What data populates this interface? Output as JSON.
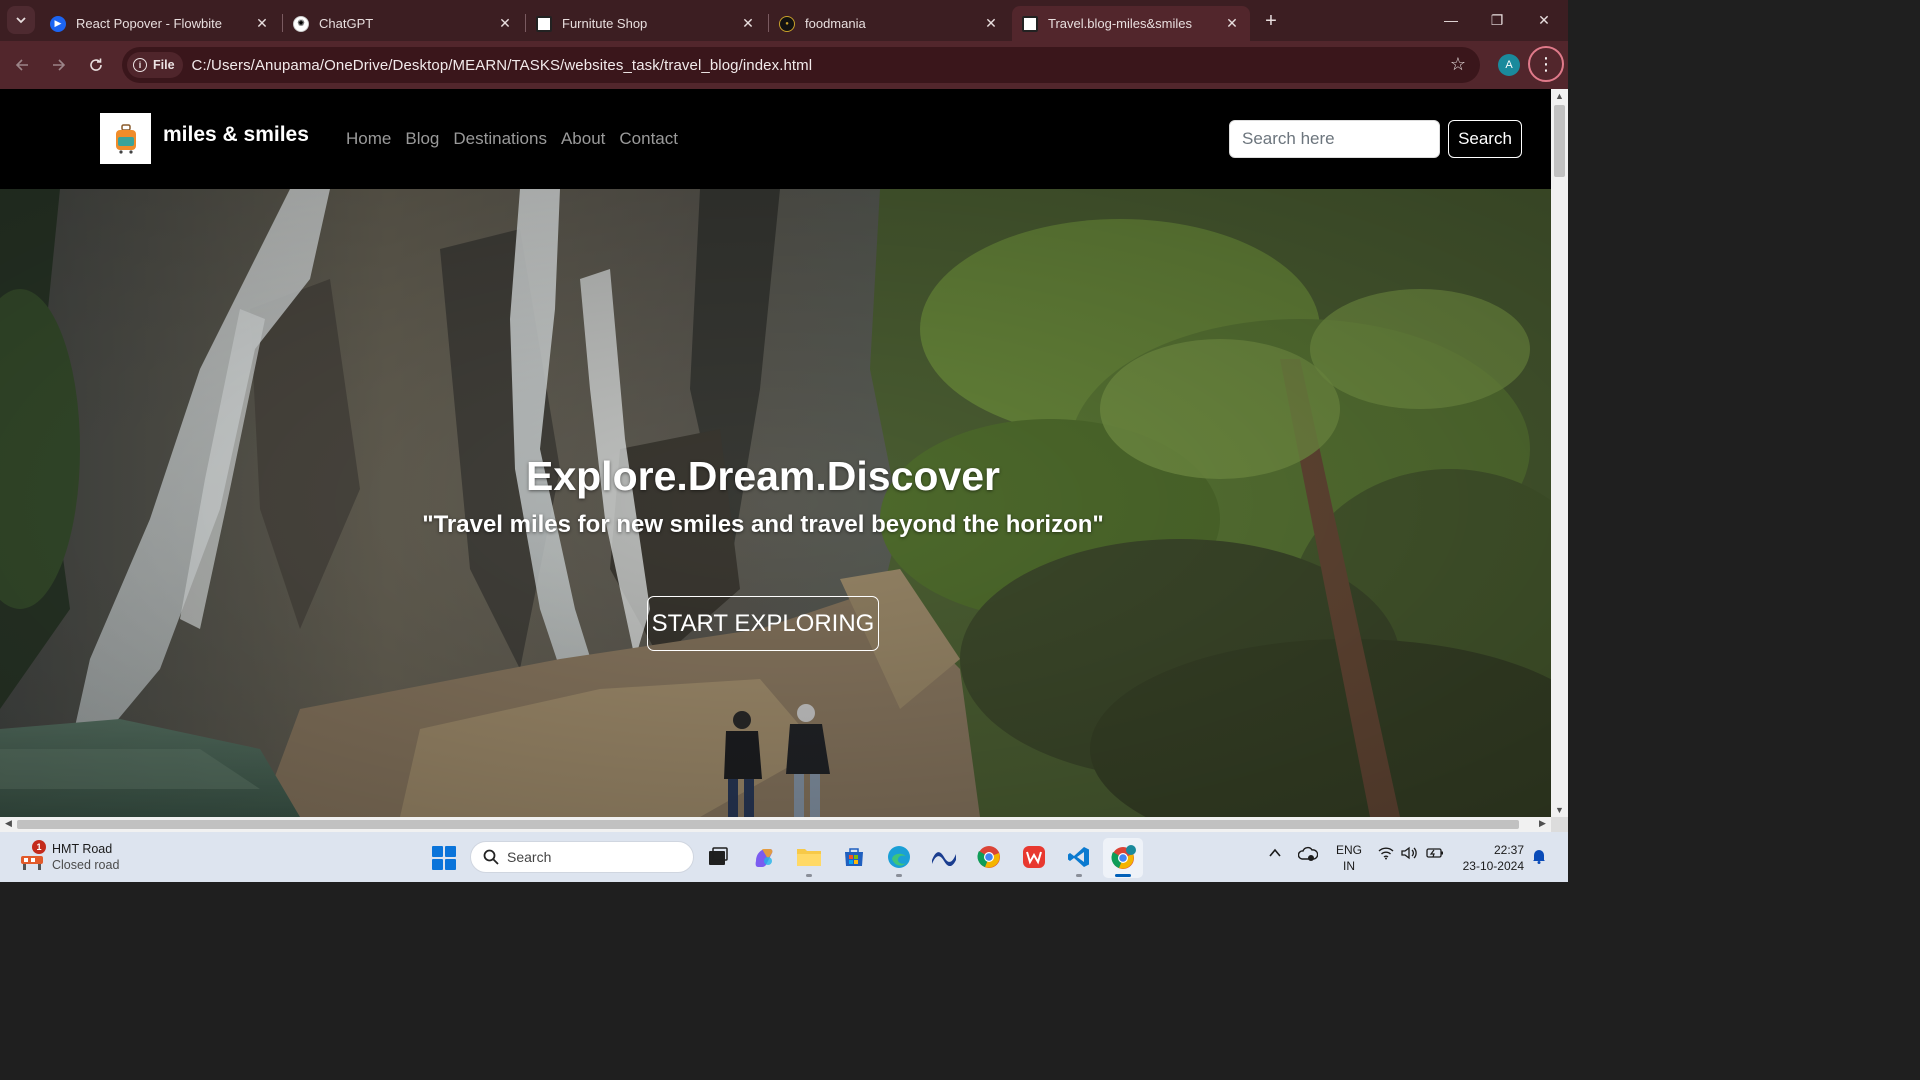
{
  "browser": {
    "tabs": [
      {
        "title": "React Popover - Flowbite",
        "active": false
      },
      {
        "title": "ChatGPT",
        "active": false
      },
      {
        "title": "Furnitute Shop",
        "active": false
      },
      {
        "title": "foodmania",
        "active": false
      },
      {
        "title": "Travel.blog-miles&smiles",
        "active": true
      }
    ],
    "new_tab_label": "+",
    "window_controls": {
      "minimize": "—",
      "restore": "❐",
      "close": "✕"
    },
    "address_bar": {
      "scheme_chip": "File",
      "url": "C:/Users/Anupama/OneDrive/Desktop/MEARN/TASKS/websites_task/travel_blog/index.html"
    },
    "profile_initial": "A",
    "accent_color": "#52262c"
  },
  "site": {
    "brand": "miles & smiles",
    "nav": [
      "Home",
      "Blog",
      "Destinations",
      "About",
      "Contact"
    ],
    "search": {
      "placeholder": "Search here",
      "button": "Search"
    },
    "hero": {
      "title": "Explore.Dream.Discover",
      "subtitle": "\"Travel miles for new smiles and travel beyond the horizon\"",
      "cta": "START EXPLORING"
    }
  },
  "taskbar": {
    "weather": {
      "title": "HMT Road",
      "subtitle": "Closed road",
      "badge": "1"
    },
    "search_label": "Search",
    "apps": [
      "task-view",
      "copilot",
      "file-explorer",
      "microsoft-store",
      "edge",
      "vpn",
      "chrome",
      "wps-office",
      "vscode",
      "chrome-active"
    ],
    "language": {
      "line1": "ENG",
      "line2": "IN"
    },
    "clock": {
      "time": "22:37",
      "date": "23-10-2024"
    }
  }
}
